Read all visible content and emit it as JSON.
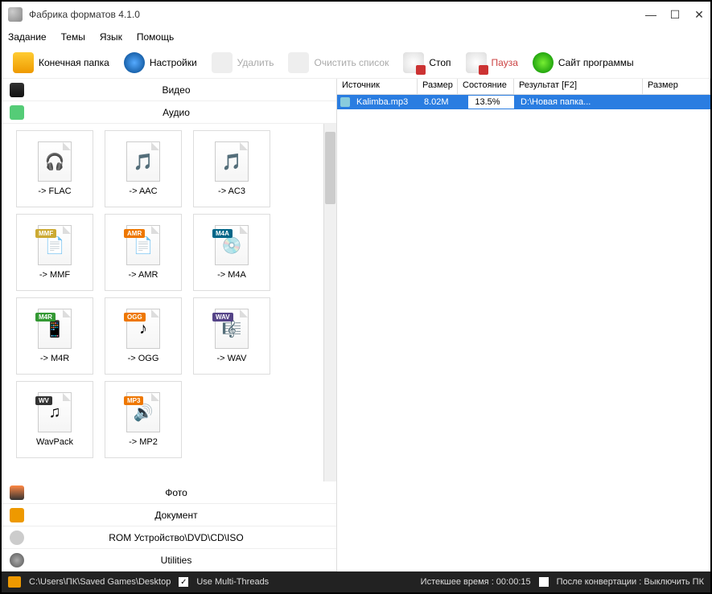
{
  "title": "Фабрика форматов 4.1.0",
  "menu": [
    "Задание",
    "Темы",
    "Язык",
    "Помощь"
  ],
  "toolbar": {
    "output_folder": "Конечная папка",
    "settings": "Настройки",
    "delete": "Удалить",
    "clear_list": "Очистить список",
    "stop": "Стоп",
    "pause": "Пауза",
    "website": "Сайт программы"
  },
  "categories": {
    "video": "Видео",
    "audio": "Аудио",
    "photo": "Фото",
    "document": "Документ",
    "rom": "ROM Устройство\\DVD\\CD\\ISO",
    "utilities": "Utilities"
  },
  "formats": [
    {
      "label": "-> FLAC",
      "badge": ""
    },
    {
      "label": "-> AAC",
      "badge": ""
    },
    {
      "label": "-> AC3",
      "badge": ""
    },
    {
      "label": "-> MMF",
      "badge": "MMF",
      "bcls": "b-mmf"
    },
    {
      "label": "-> AMR",
      "badge": "AMR",
      "bcls": "b-amr"
    },
    {
      "label": "-> M4A",
      "badge": "M4A",
      "bcls": "b-m4a"
    },
    {
      "label": "-> M4R",
      "badge": "M4R",
      "bcls": "b-m4r"
    },
    {
      "label": "-> OGG",
      "badge": "OGG",
      "bcls": "b-ogg"
    },
    {
      "label": "-> WAV",
      "badge": "WAV",
      "bcls": "b-wav"
    },
    {
      "label": "WavPack",
      "badge": "WV",
      "bcls": "b-wv"
    },
    {
      "label": "-> MP2",
      "badge": "MP3",
      "bcls": "b-mp3"
    }
  ],
  "table": {
    "headers": {
      "source": "Источник",
      "size": "Размер",
      "state": "Состояние",
      "result": "Результат [F2]",
      "size2": "Размер"
    },
    "row": {
      "file": "Kalimba.mp3",
      "size": "8.02M",
      "progress": "13.5%",
      "output": "D:\\Новая папка..."
    }
  },
  "status": {
    "path": "C:\\Users\\ПК\\Saved Games\\Desktop",
    "multithread": "Use Multi-Threads",
    "elapsed": "Истекшее время : 00:00:15",
    "after": "После конвертации : Выключить ПК"
  }
}
